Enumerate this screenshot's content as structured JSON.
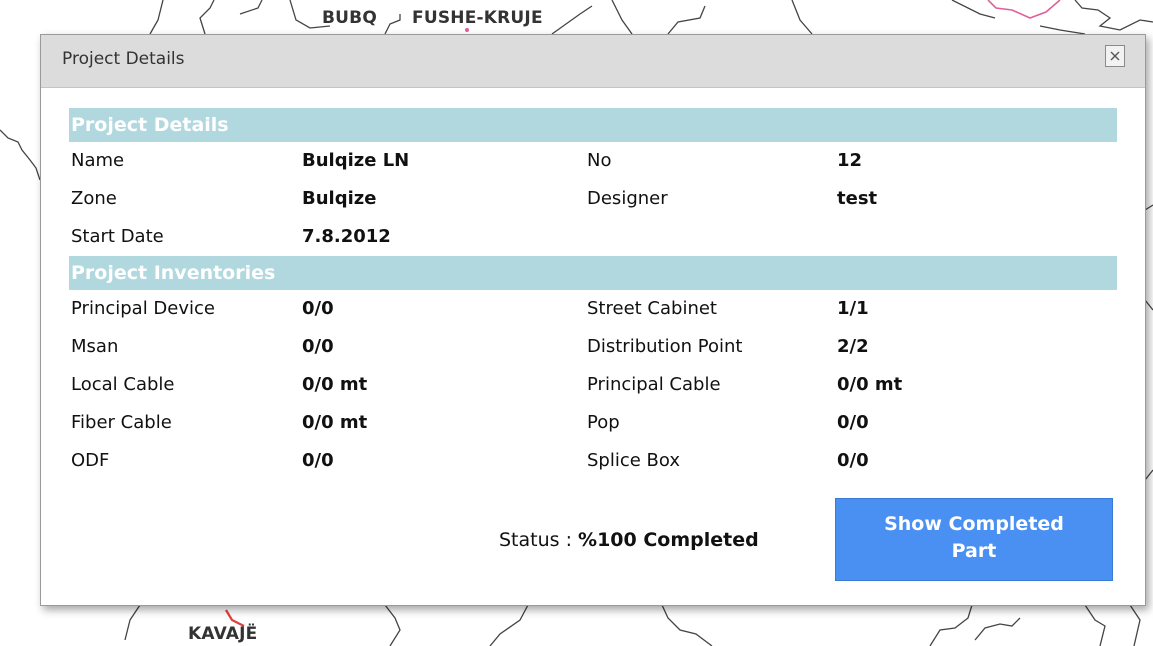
{
  "map": {
    "labels": [
      "BUBQ",
      "FUSHE-KRUJE",
      "KAVAJË"
    ]
  },
  "dialog": {
    "title": "Project Details",
    "close_icon": "close-icon",
    "details_header": "Project Details",
    "details": [
      {
        "label1": "Name",
        "value1": "Bulqize LN",
        "label2": "No",
        "value2": "12"
      },
      {
        "label1": "Zone",
        "value1": "Bulqize",
        "label2": "Designer",
        "value2": "test"
      },
      {
        "label1": "Start Date",
        "value1": "7.8.2012",
        "label2": "",
        "value2": ""
      }
    ],
    "inventories_header": "Project Inventories",
    "inventories": [
      {
        "label1": "Principal Device",
        "value1": "0/0",
        "label2": "Street Cabinet",
        "value2": "1/1"
      },
      {
        "label1": "Msan",
        "value1": "0/0",
        "label2": "Distribution Point",
        "value2": "2/2"
      },
      {
        "label1": "Local Cable",
        "value1": "0/0 mt",
        "label2": "Principal Cable",
        "value2": "0/0 mt"
      },
      {
        "label1": "Fiber Cable",
        "value1": "0/0 mt",
        "label2": "Pop",
        "value2": "0/0"
      },
      {
        "label1": "ODF",
        "value1": "0/0",
        "label2": "Splice Box",
        "value2": "0/0"
      }
    ],
    "status_label": "Status :",
    "status_value": "%100 Completed",
    "show_completed_line1": "Show Completed",
    "show_completed_line2": "Part"
  },
  "colors": {
    "section_header_bg": "#b0d8de",
    "button_bg": "#4a90f2",
    "titlebar_bg": "#dcdcdc",
    "map_border_pink": "#e0609a"
  }
}
